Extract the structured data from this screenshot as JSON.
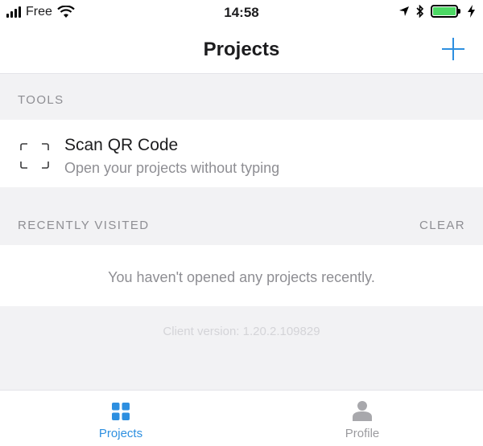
{
  "status_bar": {
    "carrier": "Free",
    "time": "14:58",
    "battery_level": 1.0,
    "icons": [
      "signal-icon",
      "wifi-icon",
      "location-arrow-icon",
      "bluetooth-icon",
      "battery-icon",
      "charging-icon"
    ]
  },
  "nav": {
    "title": "Projects",
    "add_icon": "plus-icon"
  },
  "tools_section": {
    "header": "TOOLS",
    "item": {
      "icon": "qr-scan-icon",
      "title": "Scan QR Code",
      "subtitle": "Open your projects without typing"
    }
  },
  "recent_section": {
    "header": "RECENTLY VISITED",
    "clear_label": "CLEAR",
    "empty_message": "You haven't opened any projects recently."
  },
  "client_version": "Client version: 1.20.2.109829",
  "tab_bar": {
    "tabs": [
      {
        "label": "Projects",
        "icon": "grid-icon",
        "active": true
      },
      {
        "label": "Profile",
        "icon": "person-icon",
        "active": false
      }
    ]
  },
  "colors": {
    "accent": "#2d8fe0",
    "battery_green": "#4cd964",
    "secondary_text": "#8e8e93",
    "background": "#f2f2f4"
  }
}
